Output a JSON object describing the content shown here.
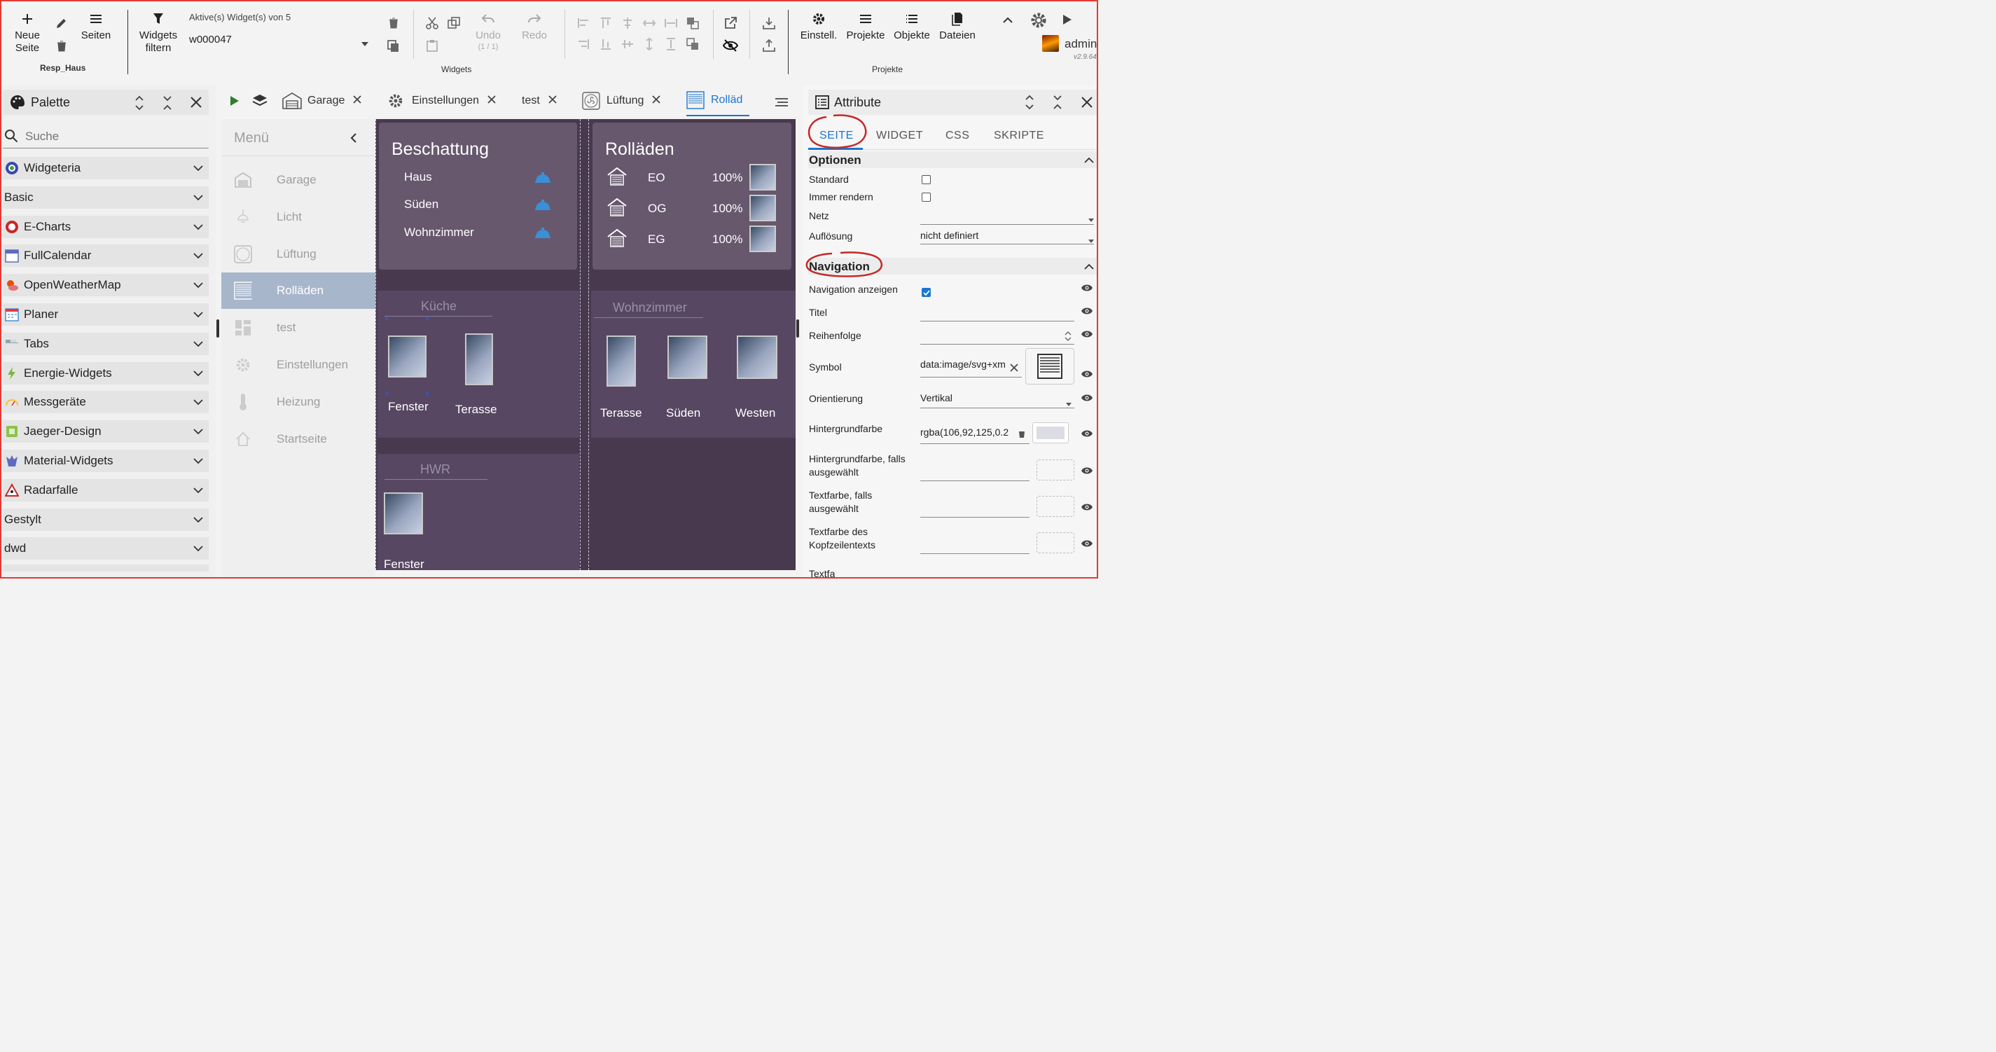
{
  "toolbar": {
    "new_page": "Neue Seite",
    "pages": "Seiten",
    "project_name": "Resp_Haus",
    "filter_widgets": "Widgets filtern",
    "active_widgets": "Aktive(s) Widget(s) von 5",
    "selected_widget": "w000047",
    "undo": "Undo",
    "undo_count": "(1 / 1)",
    "redo": "Redo",
    "widgets_group": "Widgets",
    "settings": "Einstell.",
    "projects": "Projekte",
    "objects": "Objekte",
    "files": "Dateien",
    "projects_group": "Projekte",
    "user": "admin",
    "version": "v2.9.64"
  },
  "palette": {
    "title": "Palette",
    "search_placeholder": "Suche",
    "items": [
      {
        "label": "Widgeteria",
        "icon": "globe-icon"
      },
      {
        "label": "Basic",
        "icon": ""
      },
      {
        "label": "E-Charts",
        "icon": "echarts-icon"
      },
      {
        "label": "FullCalendar",
        "icon": "calendar-icon"
      },
      {
        "label": "OpenWeatherMap",
        "icon": "weather-icon"
      },
      {
        "label": "Planer",
        "icon": "planner-icon"
      },
      {
        "label": "Tabs",
        "icon": "tabs-icon"
      },
      {
        "label": "Energie-Widgets",
        "icon": "energy-icon"
      },
      {
        "label": "Messgeräte",
        "icon": "gauge-icon"
      },
      {
        "label": "Jaeger-Design",
        "icon": "jaeger-icon"
      },
      {
        "label": "Material-Widgets",
        "icon": "material-icon"
      },
      {
        "label": "Radarfalle",
        "icon": "radar-icon"
      },
      {
        "label": "Gestylt",
        "icon": ""
      },
      {
        "label": "dwd",
        "icon": ""
      }
    ]
  },
  "tabs": [
    {
      "label": "Garage",
      "icon": "garage-icon"
    },
    {
      "label": "Einstellungen",
      "icon": "gear-icon"
    },
    {
      "label": "test",
      "icon": ""
    },
    {
      "label": "Lüftung",
      "icon": "fan-icon"
    },
    {
      "label": "Rolläd",
      "icon": "shutter-icon"
    }
  ],
  "menu": {
    "title": "Menü",
    "items": [
      {
        "label": "Garage",
        "icon": "garage-icon"
      },
      {
        "label": "Licht",
        "icon": "lamp-icon"
      },
      {
        "label": "Lüftung",
        "icon": "fan-icon"
      },
      {
        "label": "Rolläden",
        "icon": "shutter-icon",
        "active": true
      },
      {
        "label": "test",
        "icon": "dashboard-icon"
      },
      {
        "label": "Einstellungen",
        "icon": "gear-icon"
      },
      {
        "label": "Heizung",
        "icon": "thermometer-icon"
      },
      {
        "label": "Startseite",
        "icon": "home-icon"
      }
    ]
  },
  "canvas": {
    "beschattung": {
      "title": "Beschattung",
      "items": [
        "Haus",
        "Süden",
        "Wohnzimmer"
      ]
    },
    "rollaeden": {
      "title": "Rolläden",
      "items": [
        {
          "label": "EO",
          "value": "100%"
        },
        {
          "label": "OG",
          "value": "100%"
        },
        {
          "label": "EG",
          "value": "100%"
        }
      ]
    },
    "kueche": {
      "title": "Küche",
      "items": [
        "Fenster",
        "Terasse"
      ]
    },
    "wohnzimmer": {
      "title": "Wohnzimmer",
      "items": [
        "Terasse",
        "Süden",
        "Westen"
      ]
    },
    "hwr": {
      "title": "HWR",
      "items": [
        "Fenster"
      ]
    }
  },
  "attributes": {
    "title": "Attribute",
    "tabs": [
      "SEITE",
      "WIDGET",
      "CSS",
      "SKRIPTE"
    ],
    "options_title": "Optionen",
    "standard": "Standard",
    "always_render": "Immer rendern",
    "network": "Netz",
    "resolution": "Auflösung",
    "resolution_value": "nicht definiert",
    "navigation_title": "Navigation",
    "show_navigation": "Navigation anzeigen",
    "show_navigation_checked": true,
    "title_label": "Titel",
    "order": "Reihenfolge",
    "symbol": "Symbol",
    "symbol_value": "data:image/svg+xm",
    "orientation": "Orientierung",
    "orientation_value": "Vertikal",
    "background_color": "Hintergrundfarbe",
    "background_color_value": "rgba(106,92,125,0.2",
    "bg_selected": "Hintergrundfarbe, falls ausgewählt",
    "text_selected": "Textfarbe, falls ausgewählt",
    "header_text_color": "Textfarbe des Kopfzeilentexts",
    "cut_off": "Textfa"
  },
  "colors": {
    "accent": "#1976d2",
    "annotation": "#c62828",
    "canvas_bg": "#48394f",
    "card_bg": "#67586e",
    "menu_active": "#a8b6cc"
  }
}
